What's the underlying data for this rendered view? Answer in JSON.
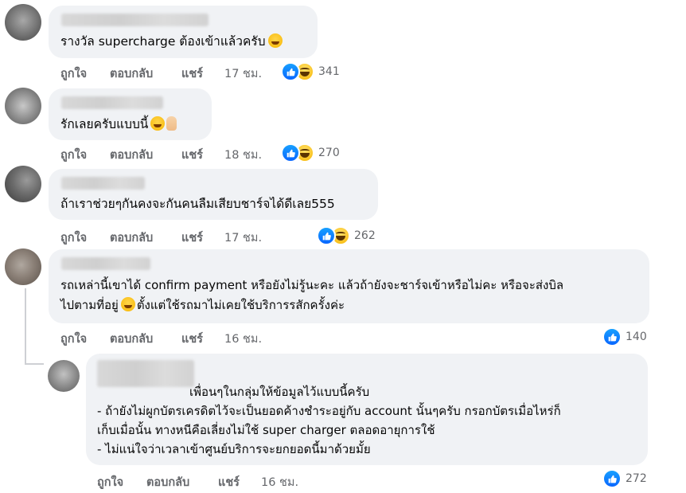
{
  "actions": {
    "like": "ถูกใจ",
    "reply": "ตอบกลับ",
    "share": "แชร์"
  },
  "comments": [
    {
      "text": "รางวัล supercharge ต้องเข้าแล้วครับ",
      "emoji": "rolling-laughing-emoji",
      "time": "17 ชม.",
      "reactions": [
        "like",
        "haha"
      ],
      "reaction_count": "341"
    },
    {
      "text": "รักเลยครับแบบนี้",
      "emoji": "grinning-emoji",
      "time": "18 ชม.",
      "reactions": [
        "like",
        "haha"
      ],
      "reaction_count": "270"
    },
    {
      "text": "ถ้าเราช่วยๆกันคงจะกันคนลืมเสียบชาร์จได้ดีเลย555",
      "time": "17 ชม.",
      "reactions": [
        "like",
        "haha"
      ],
      "reaction_count": "262"
    },
    {
      "line1": "รถเหล่านี้เขาได้ confirm payment หรือยังไม่รู้นะคะ แล้วถ้ายังจะชาร์จเข้าหรือไม่คะ หรือจะส่งบิล",
      "line2a": "ไปตามที่อยู่",
      "line2b": "ตั้งแต่ใช้รถมาไม่เคยใช้บริการรสักครั้งค่ะ",
      "time": "16 ชม.",
      "reactions": [
        "like"
      ],
      "reaction_count": "140"
    }
  ],
  "reply": {
    "line1": "เพื่อนๆในกลุ่มให้ข้อมูลไว้แบบนี้ครับ",
    "line2": "- ถ้ายังไม่ผูกบัตรเครดิตไว้จะเป็นยอดค้างชำระอยู่กับ account นั้นๆครับ กรอกบัตรเมื่อไหร่ก็",
    "line3": "เก็บเมื่อนั้น ทางหนีคือเลี่ยงไม่ใช้ super charger ตลอดอายุการใช้",
    "line4": "- ไม่แน่ใจว่าเวลาเข้าศูนย์บริการจะยกยอดนี้มาด้วยมั้ย",
    "time": "16 ชม.",
    "reactions": [
      "like"
    ],
    "reaction_count": "272"
  },
  "colors": {
    "bubble": "#f0f2f5",
    "meta": "#65676b",
    "like_blue": "#0866ff"
  }
}
